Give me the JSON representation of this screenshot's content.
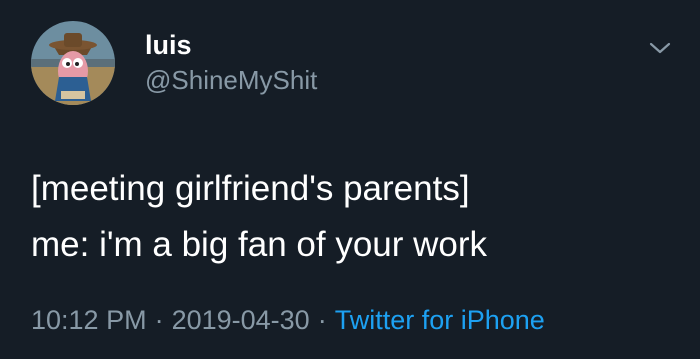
{
  "user": {
    "display_name": "luis",
    "handle": "@ShineMyShit"
  },
  "tweet": {
    "lines": [
      "[meeting girlfriend's parents]",
      "me: i'm a big fan of your work"
    ]
  },
  "meta": {
    "time": "10:12 PM",
    "separator": "·",
    "date": "2019-04-30",
    "source": "Twitter for iPhone"
  },
  "icons": {
    "more": "chevron-down-icon",
    "avatar": "avatar"
  },
  "colors": {
    "background": "#151d26",
    "primary_text": "#ffffff",
    "secondary_text": "#8899a6",
    "link": "#1da1f2"
  }
}
